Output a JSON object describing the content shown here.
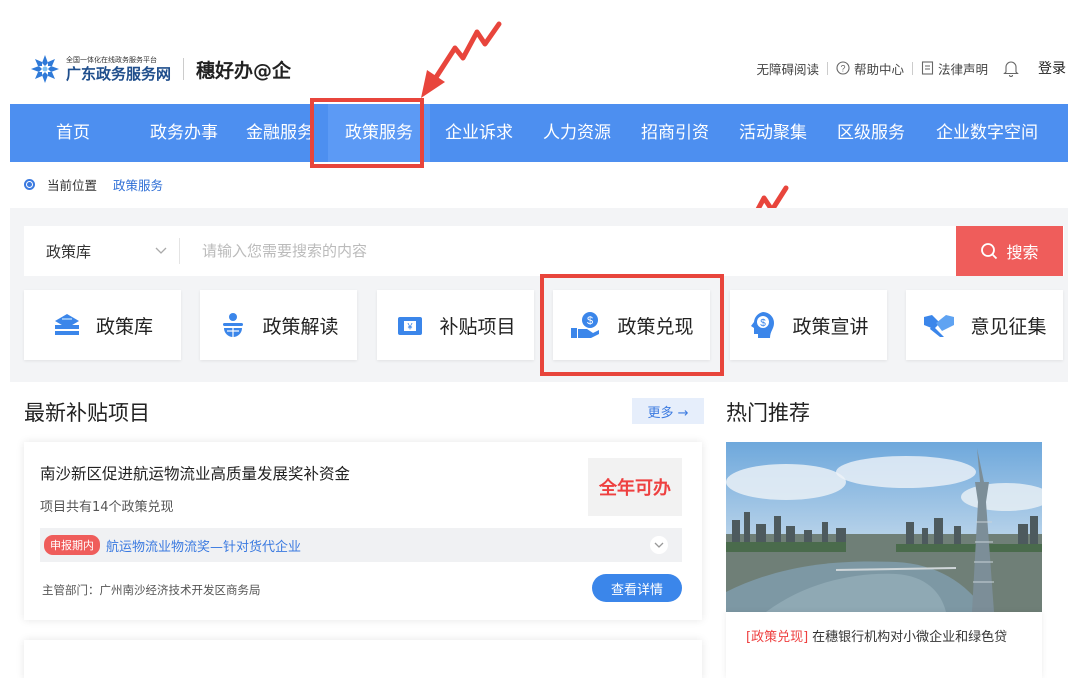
{
  "header": {
    "logo_sub": "全国一体化在线政务服务平台",
    "logo_main": "广东政务服务网",
    "brand": "穗好办@企",
    "links": {
      "accessibility": "无障碍阅读",
      "help": "帮助中心",
      "legal": "法律声明",
      "login": "登录"
    }
  },
  "nav": {
    "items": [
      {
        "label": "首页"
      },
      {
        "label": "政务办事"
      },
      {
        "label": "金融服务"
      },
      {
        "label": "政策服务"
      },
      {
        "label": "企业诉求"
      },
      {
        "label": "人力资源"
      },
      {
        "label": "招商引资"
      },
      {
        "label": "活动聚集"
      },
      {
        "label": "区级服务"
      },
      {
        "label": "企业数字空间"
      }
    ],
    "active": "政策服务"
  },
  "breadcrumb": {
    "label": "当前位置",
    "current": "政策服务"
  },
  "search": {
    "select_value": "政策库",
    "placeholder": "请输入您需要搜索的内容",
    "button": "搜索"
  },
  "categories": [
    {
      "label": "政策库",
      "icon": "stack-icon"
    },
    {
      "label": "政策解读",
      "icon": "globe-person-icon"
    },
    {
      "label": "补贴项目",
      "icon": "wallet-icon"
    },
    {
      "label": "政策兑现",
      "icon": "hand-coin-icon"
    },
    {
      "label": "政策宣讲",
      "icon": "dollar-head-icon"
    },
    {
      "label": "意见征集",
      "icon": "handshake-icon"
    }
  ],
  "latest": {
    "title": "最新补贴项目",
    "more": "更多 →",
    "card": {
      "title": "南沙新区促进航运物流业高质量发展奖补资金",
      "subtitle": "项目共有14个政策兑现",
      "tag": "全年可办",
      "status": "申报期内",
      "item": "航运物流业物流奖—针对货代企业",
      "dept": "主管部门：广州南沙经济技术开发区商务局",
      "button": "查看详情"
    }
  },
  "hot": {
    "title": "热门推荐",
    "caption_tag": "[政策兑现]",
    "caption_text": "在穗银行机构对小微企业和绿色贷"
  },
  "colors": {
    "nav": "#4d8ff0",
    "highlight": "#e8453c",
    "search_button": "#ef5d5b",
    "link": "#3b7ae0"
  }
}
